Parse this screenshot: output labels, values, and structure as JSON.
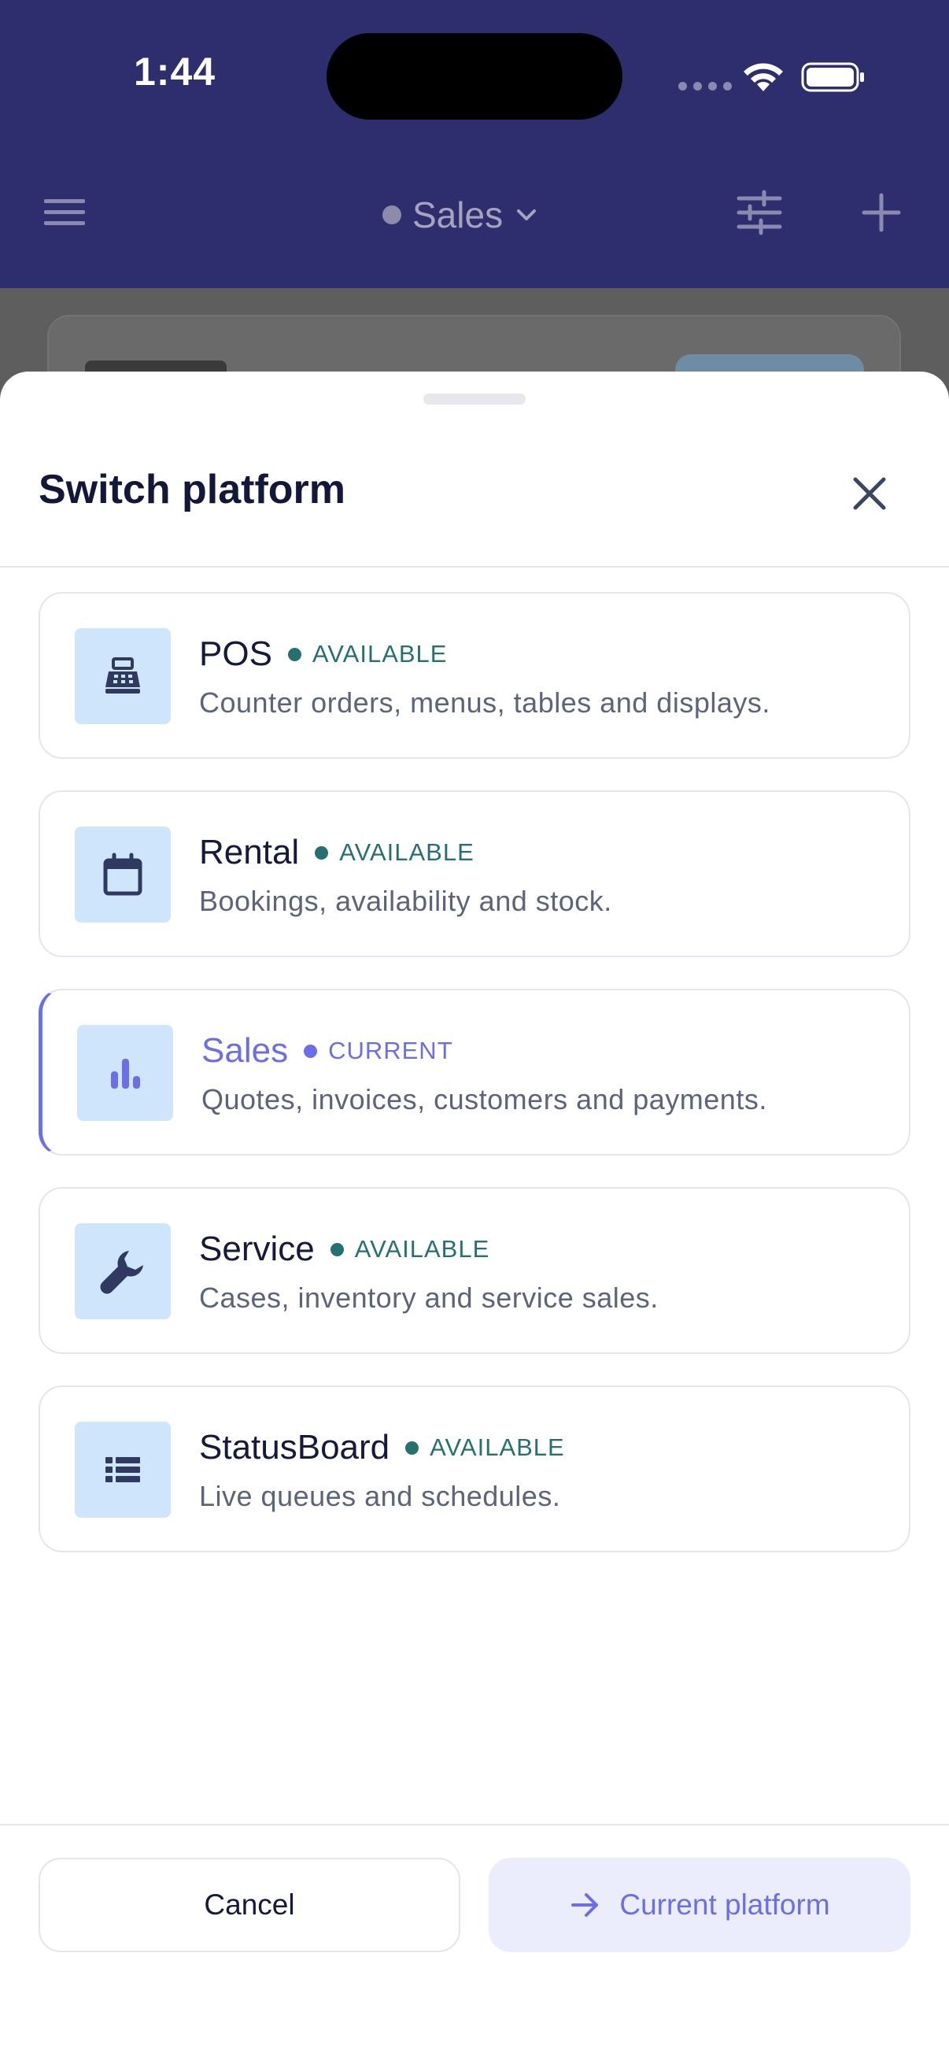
{
  "status_bar": {
    "time": "1:44"
  },
  "header": {
    "title": "Sales",
    "menu_icon": "hamburger-menu-icon",
    "chevron_icon": "chevron-down-icon",
    "filter_icon": "sliders-icon",
    "add_icon": "plus-icon"
  },
  "sheet": {
    "title": "Switch platform",
    "close_icon": "close-icon",
    "platforms": [
      {
        "name": "POS",
        "status": "AVAILABLE",
        "description": "Counter orders, menus, tables and displays.",
        "icon": "cash-register-icon",
        "current": false
      },
      {
        "name": "Rental",
        "status": "AVAILABLE",
        "description": "Bookings, availability and stock.",
        "icon": "calendar-icon",
        "current": false
      },
      {
        "name": "Sales",
        "status": "CURRENT",
        "description": "Quotes, invoices, customers and payments.",
        "icon": "bar-chart-icon",
        "current": true
      },
      {
        "name": "Service",
        "status": "AVAILABLE",
        "description": "Cases, inventory and service sales.",
        "icon": "wrench-icon",
        "current": false
      },
      {
        "name": "StatusBoard",
        "status": "AVAILABLE",
        "description": "Live queues and schedules.",
        "icon": "list-icon",
        "current": false
      }
    ],
    "cancel_label": "Cancel",
    "confirm_label": "Current platform",
    "confirm_icon": "arrow-right-icon"
  },
  "colors": {
    "header_bg": "#2e2e6e",
    "accent": "#6b6ee6",
    "available": "#267070",
    "icon_tile": "#cfe5fb",
    "text_primary": "#141a3c"
  }
}
